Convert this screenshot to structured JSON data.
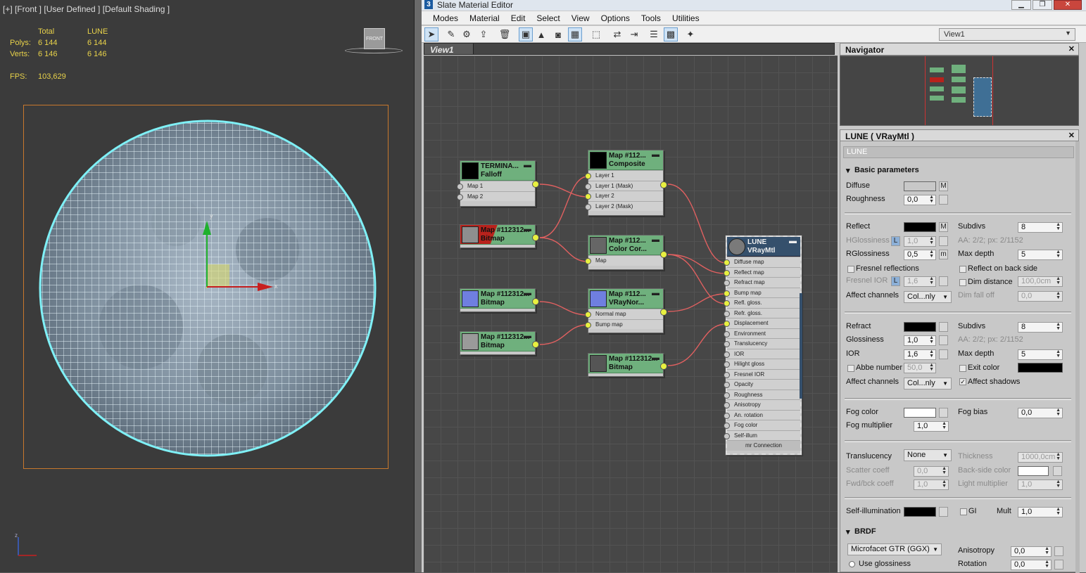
{
  "viewport": {
    "label": "[+] [Front ] [User Defined ] [Default Shading ]",
    "stats": {
      "col_total": "Total",
      "col_obj": "LUNE",
      "polys_label": "Polys:",
      "polys_total": "6 144",
      "polys_obj": "6 144",
      "verts_label": "Verts:",
      "verts_total": "6 146",
      "verts_obj": "6 146",
      "fps_label": "FPS:",
      "fps_value": "103,629"
    },
    "viewcube_label": "FRONT",
    "gizmo": {
      "x": "x",
      "y": "y",
      "z": "z"
    }
  },
  "editor": {
    "title": "Slate Material Editor",
    "app_icon": "3",
    "menu": [
      "Modes",
      "Material",
      "Edit",
      "Select",
      "View",
      "Options",
      "Tools",
      "Utilities"
    ],
    "view_select": "View1",
    "view_tab": "View1"
  },
  "nodes": {
    "falloff": {
      "title1": "TERMINA...",
      "title2": "Falloff",
      "slots": [
        "Map 1",
        "Map 2"
      ]
    },
    "bitmap_red": {
      "title1": "Map #112312...",
      "title2": "Bitmap"
    },
    "composite": {
      "title1": "Map #112...",
      "title2": "Composite",
      "slots": [
        "Layer 1",
        "Layer 1 (Mask)",
        "Layer 2",
        "Layer 2 (Mask)"
      ]
    },
    "colorcor": {
      "title1": "Map #112...",
      "title2": "Color Cor...",
      "slots": [
        "Map"
      ]
    },
    "bitmap_blue": {
      "title1": "Map #112312...",
      "title2": "Bitmap"
    },
    "vraynor": {
      "title1": "Map #112...",
      "title2": "VRayNor...",
      "slots": [
        "Normal map",
        "Bump map"
      ]
    },
    "bitmap_grey": {
      "title1": "Map #112312...",
      "title2": "Bitmap"
    },
    "bitmap_moon": {
      "title1": "Map #112312...",
      "title2": "Bitmap"
    },
    "lune": {
      "title1": "LUNE",
      "title2": "VRayMtl",
      "slots": [
        "Diffuse map",
        "Reflect map",
        "Refract map",
        "Bump map",
        "Refl. gloss.",
        "Refr. gloss.",
        "Displacement",
        "Environment",
        "Translucency",
        "IOR",
        "Hilight gloss",
        "Fresnel IOR",
        "Opacity",
        "Roughness",
        "Anisotropy",
        "An. rotation",
        "Fog color",
        "Self-illum"
      ],
      "footer": "mr Connection"
    }
  },
  "navigator": {
    "title": "Navigator"
  },
  "params": {
    "title": "LUNE  ( VRayMtl )",
    "name_field": "LUNE",
    "basic": "Basic parameters",
    "diffuse": "Diffuse",
    "roughness": "Roughness",
    "roughness_val": "0,0",
    "reflect": "Reflect",
    "hgloss": "HGlossiness",
    "hgloss_val": "1,0",
    "rgloss": "RGlossiness",
    "rgloss_val": "0,5",
    "fresnel": "Fresnel reflections",
    "fresnel_ior": "Fresnel IOR",
    "fresnel_ior_val": "1,6",
    "affect": "Affect channels",
    "affect_val": "Col...nly",
    "subdivs": "Subdivs",
    "subdivs_val": "8",
    "aa": "AA: 2/2; px: 2/1152",
    "maxdepth": "Max depth",
    "maxdepth_val": "5",
    "reflect_back": "Reflect on back side",
    "dim_dist": "Dim distance",
    "dim_dist_val": "100,0cm",
    "dim_falloff": "Dim fall off",
    "dim_falloff_val": "0,0",
    "refract": "Refract",
    "gloss": "Glossiness",
    "gloss_val": "1,0",
    "ior": "IOR",
    "ior_val": "1,6",
    "abbe": "Abbe number",
    "abbe_val": "50,0",
    "r_subdivs_val": "8",
    "r_aa": "AA: 2/2; px: 2/1152",
    "r_maxdepth_val": "5",
    "exit_color": "Exit color",
    "affect_shadows": "Affect shadows",
    "fog_color": "Fog color",
    "fog_mult": "Fog multiplier",
    "fog_mult_val": "1,0",
    "fog_bias": "Fog bias",
    "fog_bias_val": "0,0",
    "translucency": "Translucency",
    "transl_val": "None",
    "thickness": "Thickness",
    "thickness_val": "1000,0cm",
    "scatter": "Scatter coeff",
    "scatter_val": "0,0",
    "fwd": "Fwd/bck coeff",
    "fwd_val": "1,0",
    "backside": "Back-side color",
    "light_mult": "Light multiplier",
    "light_mult_val": "1,0",
    "selfillum": "Self-illumination",
    "gi": "GI",
    "mult": "Mult",
    "mult_val": "1,0",
    "brdf": "BRDF",
    "brdf_type": "Microfacet GTR (GGX)",
    "use_gloss": "Use glossiness",
    "aniso": "Anisotropy",
    "aniso_val": "0,0",
    "rotation": "Rotation",
    "rotation_val": "0,0",
    "m": "M",
    "l": "L",
    "mm": "m"
  }
}
